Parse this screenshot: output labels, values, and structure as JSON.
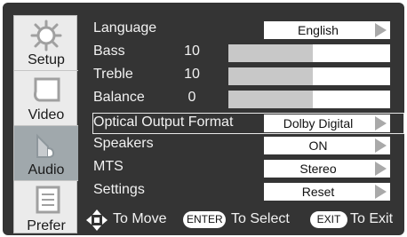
{
  "sidebar": {
    "tabs": [
      {
        "label": "Setup",
        "icon": "gear-icon",
        "active": false
      },
      {
        "label": "Video",
        "icon": "video-icon",
        "active": false
      },
      {
        "label": "Audio",
        "icon": "speaker-icon",
        "active": true
      },
      {
        "label": "Prefer",
        "icon": "preferences-icon",
        "active": false
      }
    ]
  },
  "menu": {
    "language": {
      "label": "Language",
      "value": "English"
    },
    "bass": {
      "label": "Bass",
      "value": "10",
      "level": 0.52
    },
    "treble": {
      "label": "Treble",
      "value": "10",
      "level": 0.52
    },
    "balance": {
      "label": "Balance",
      "value": "0",
      "level": 0.52
    },
    "optical": {
      "label": "Optical Output Format",
      "value": "Dolby Digital"
    },
    "speakers": {
      "label": "Speakers",
      "value": "ON"
    },
    "mts": {
      "label": "MTS",
      "value": "Stereo"
    },
    "settings": {
      "label": "Settings",
      "value": "Reset"
    }
  },
  "hints": {
    "move": "To Move",
    "enter_key": "ENTER",
    "select": "To Select",
    "exit_key": "EXIT",
    "exit": "To Exit"
  },
  "colors": {
    "background": "#343434",
    "sidebar": "#ebebeb",
    "active_tab": "#a0a8ac",
    "text": "#f2f2f2"
  }
}
